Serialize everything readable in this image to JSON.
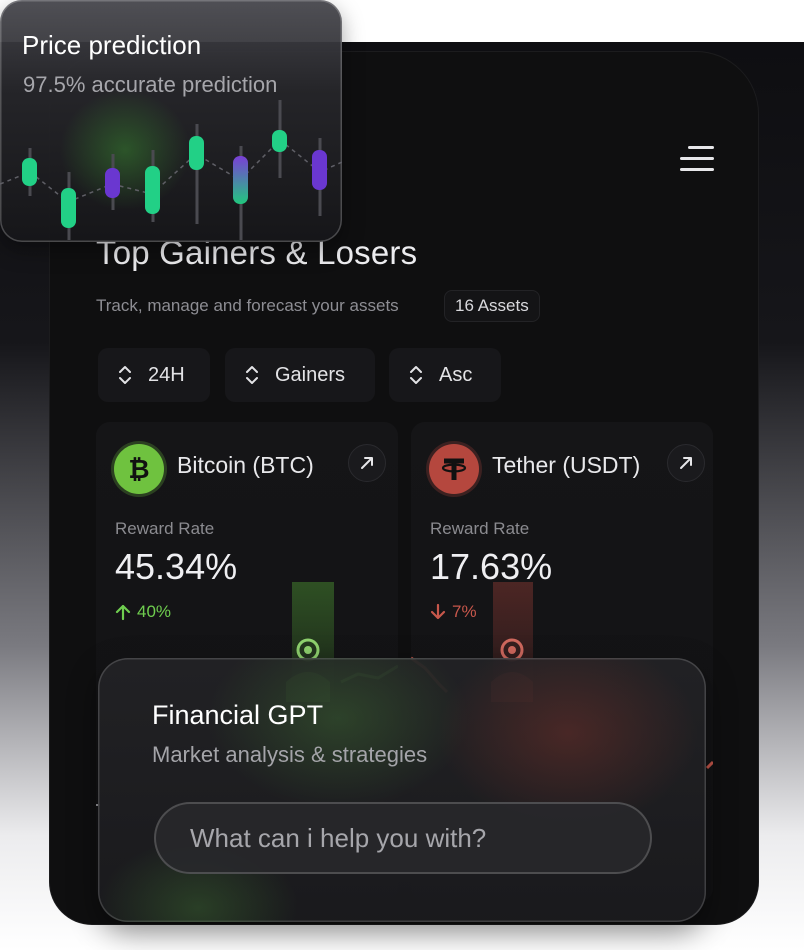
{
  "price_card": {
    "title": "Price prediction",
    "subtitle": "97.5% accurate prediction",
    "candles": [
      {
        "color": "green"
      },
      {
        "color": "green"
      },
      {
        "color": "purple"
      },
      {
        "color": "green"
      },
      {
        "color": "green"
      },
      {
        "color": "blue-green"
      },
      {
        "color": "green"
      },
      {
        "color": "purple"
      }
    ]
  },
  "header": {
    "title": "Top Gainers & Losers",
    "subtitle": "Track, manage and forecast your assets",
    "asset_count": "16 Assets",
    "menu_icon": "hamburger-menu-icon"
  },
  "filters": [
    {
      "label": "24H",
      "icon": "sort-icon"
    },
    {
      "label": "Gainers",
      "icon": "sort-icon"
    },
    {
      "label": "Asc",
      "icon": "sort-icon"
    }
  ],
  "assets": [
    {
      "name": "Bitcoin (BTC)",
      "icon": "bitcoin-icon",
      "icon_color": "#6fc23f",
      "reward_label": "Reward Rate",
      "reward_value": "45.34%",
      "change": "40%",
      "direction": "up",
      "change_color": "#6fce4f"
    },
    {
      "name": "Tether (USDT)",
      "icon": "tether-icon",
      "icon_color": "#b5473e",
      "reward_label": "Reward Rate",
      "reward_value": "17.63%",
      "change": "7%",
      "direction": "down",
      "change_color": "#c7574b"
    }
  ],
  "gpt": {
    "title": "Financial GPT",
    "subtitle": "Market analysis & strategies",
    "placeholder": "What can i help you with?"
  }
}
